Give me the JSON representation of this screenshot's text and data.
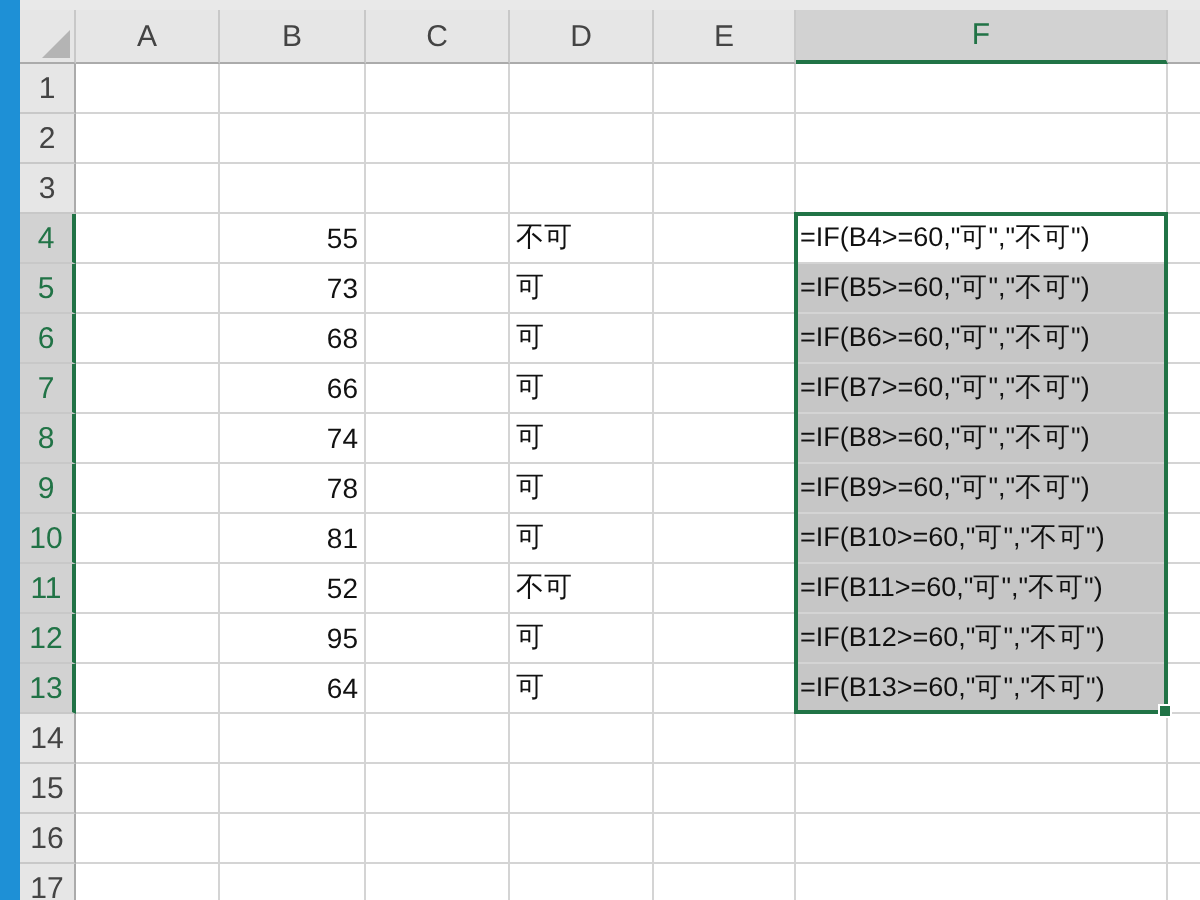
{
  "columns": [
    {
      "label": "A",
      "selected": false
    },
    {
      "label": "B",
      "selected": false
    },
    {
      "label": "C",
      "selected": false
    },
    {
      "label": "D",
      "selected": false
    },
    {
      "label": "E",
      "selected": false
    },
    {
      "label": "F",
      "selected": true
    }
  ],
  "rows": [
    {
      "header": "1",
      "selected": false
    },
    {
      "header": "2",
      "selected": false
    },
    {
      "header": "3",
      "selected": false
    },
    {
      "header": "4",
      "selected": true,
      "b": "55",
      "d": "不可",
      "f": {
        "text": "=IF(B4>=60,\"可\",\"不可\")",
        "selected": true,
        "active": true
      }
    },
    {
      "header": "5",
      "selected": true,
      "b": "73",
      "d": "可",
      "f": {
        "text": "=IF(B5>=60,\"可\",\"不可\")",
        "selected": true,
        "active": false
      }
    },
    {
      "header": "6",
      "selected": true,
      "b": "68",
      "d": "可",
      "f": {
        "text": "=IF(B6>=60,\"可\",\"不可\")",
        "selected": true,
        "active": false
      }
    },
    {
      "header": "7",
      "selected": true,
      "b": "66",
      "d": "可",
      "f": {
        "text": "=IF(B7>=60,\"可\",\"不可\")",
        "selected": true,
        "active": false
      }
    },
    {
      "header": "8",
      "selected": true,
      "b": "74",
      "d": "可",
      "f": {
        "text": "=IF(B8>=60,\"可\",\"不可\")",
        "selected": true,
        "active": false
      }
    },
    {
      "header": "9",
      "selected": true,
      "b": "78",
      "d": "可",
      "f": {
        "text": "=IF(B9>=60,\"可\",\"不可\")",
        "selected": true,
        "active": false
      }
    },
    {
      "header": "10",
      "selected": true,
      "b": "81",
      "d": "可",
      "f": {
        "text": "=IF(B10>=60,\"可\",\"不可\")",
        "selected": true,
        "active": false
      }
    },
    {
      "header": "11",
      "selected": true,
      "b": "52",
      "d": "不可",
      "f": {
        "text": "=IF(B11>=60,\"可\",\"不可\")",
        "selected": true,
        "active": false
      }
    },
    {
      "header": "12",
      "selected": true,
      "b": "95",
      "d": "可",
      "f": {
        "text": "=IF(B12>=60,\"可\",\"不可\")",
        "selected": true,
        "active": false
      }
    },
    {
      "header": "13",
      "selected": true,
      "b": "64",
      "d": "可",
      "f": {
        "text": "=IF(B13>=60,\"可\",\"不可\")",
        "selected": true,
        "active": false
      }
    },
    {
      "header": "14",
      "selected": false
    },
    {
      "header": "15",
      "selected": false
    },
    {
      "header": "16",
      "selected": false
    },
    {
      "header": "17",
      "selected": false
    }
  ]
}
